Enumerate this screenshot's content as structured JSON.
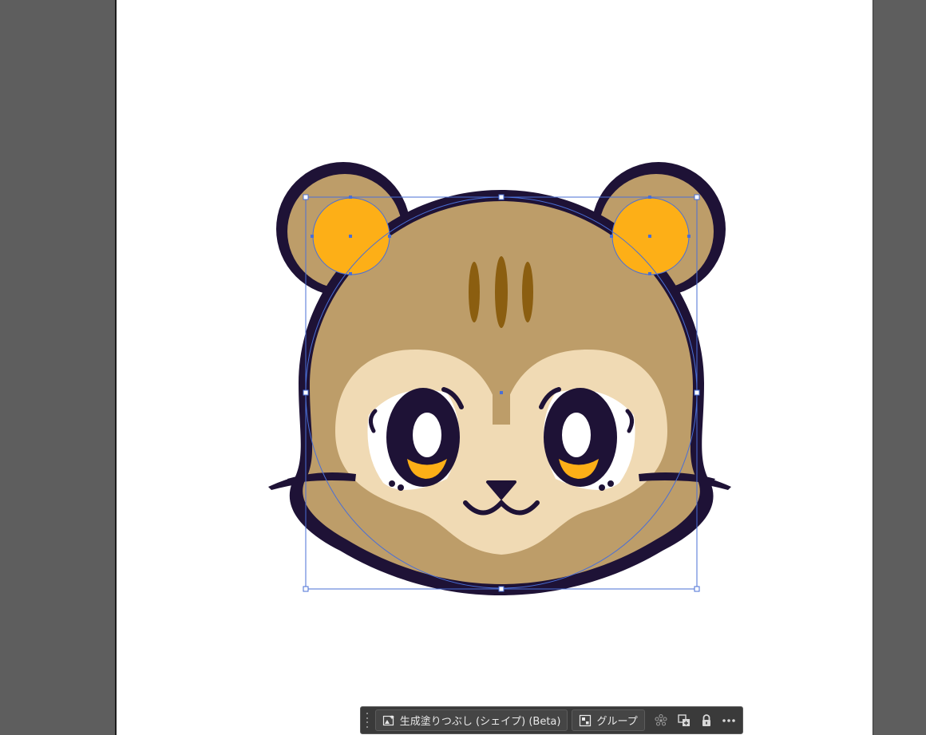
{
  "taskbar": {
    "generative_fill_label": "生成塗りつぶし (シェイプ) (Beta)",
    "group_label": "グループ",
    "icons": [
      "generative-fill-icon",
      "group-icon",
      "recolor-icon",
      "arrange-icon",
      "lock-icon",
      "more-icon"
    ]
  },
  "colors": {
    "pasteboard": "#5e5e5e",
    "artboard": "#ffffff",
    "outline": "#1e1236",
    "fur": "#bd9d69",
    "muzzle": "#f0dab4",
    "inner_ear": "#fdaf17",
    "stripe": "#8b5e10",
    "selection": "#4a6fd6"
  }
}
